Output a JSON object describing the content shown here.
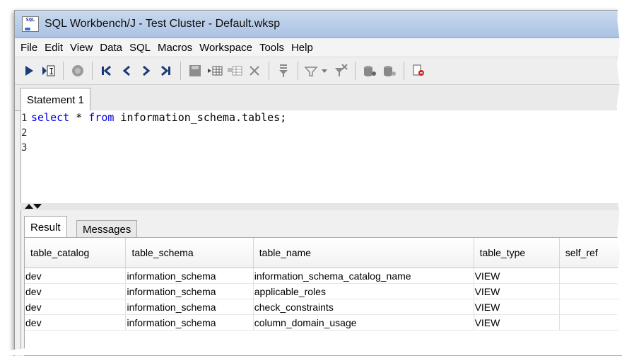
{
  "window": {
    "title": "SQL Workbench/J - Test Cluster - Default.wksp",
    "icon_text": "SQL"
  },
  "menu": [
    "File",
    "Edit",
    "View",
    "Data",
    "SQL",
    "Macros",
    "Workspace",
    "Tools",
    "Help"
  ],
  "toolbar": {
    "icons": [
      "execute-icon",
      "execute-current-icon",
      "stop-icon",
      "first-icon",
      "previous-icon",
      "next-icon",
      "last-icon",
      "save-icon",
      "insert-row-icon",
      "copy-row-icon",
      "delete-row-icon",
      "filter-icon",
      "filter-dropdown-icon",
      "remove-filter-icon",
      "commit-icon",
      "rollback-icon",
      "disconnect-icon"
    ]
  },
  "editor_tab": {
    "label": "Statement 1"
  },
  "editor": {
    "lines": [
      {
        "num": "1",
        "kw1": "select",
        "mid": " * ",
        "kw2": "from",
        "rest": " information_schema.tables;"
      },
      {
        "num": "2"
      },
      {
        "num": "3"
      }
    ]
  },
  "result_tabs": {
    "result": "Result",
    "messages": "Messages"
  },
  "table": {
    "columns": [
      "table_catalog",
      "table_schema",
      "table_name",
      "table_type",
      "self_ref"
    ],
    "rows": [
      [
        "dev",
        "information_schema",
        "information_schema_catalog_name",
        "VIEW",
        ""
      ],
      [
        "dev",
        "information_schema",
        "applicable_roles",
        "VIEW",
        ""
      ],
      [
        "dev",
        "information_schema",
        "check_constraints",
        "VIEW",
        ""
      ],
      [
        "dev",
        "information_schema",
        "column_domain_usage",
        "VIEW",
        ""
      ]
    ]
  },
  "colors": {
    "keyword": "#0000e6",
    "titlebar": "#aac3e3"
  }
}
